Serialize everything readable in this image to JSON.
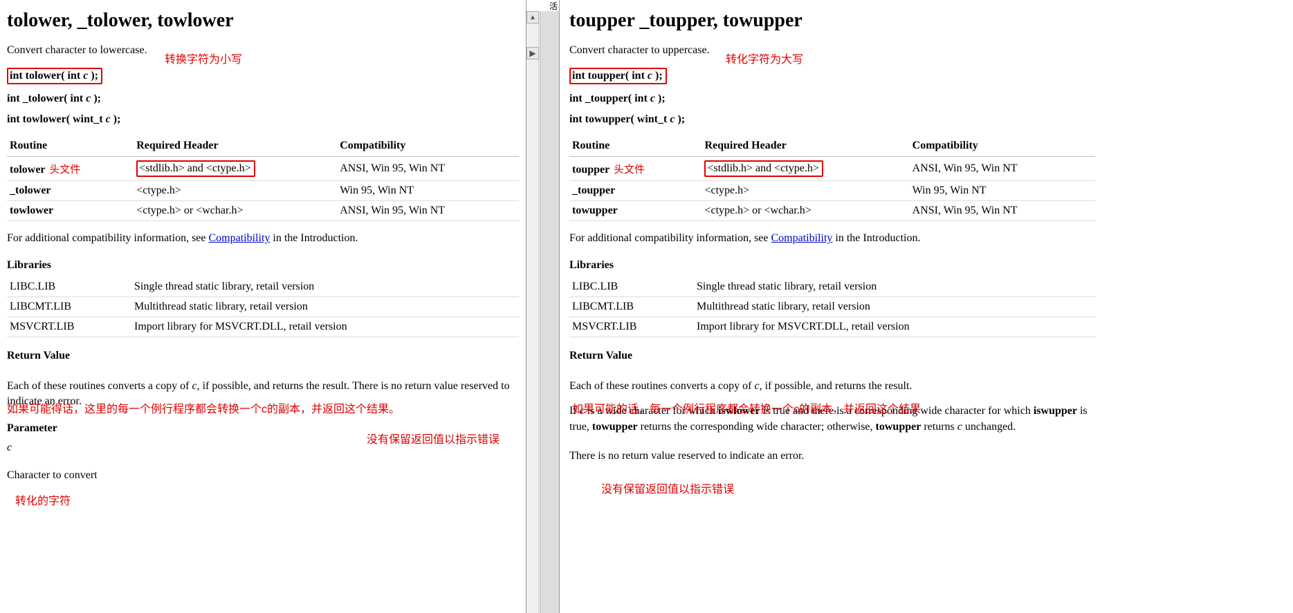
{
  "left": {
    "title": "tolower, _tolower, towlower",
    "desc": "Convert character to lowercase.",
    "desc_annot": "转换字符为小写",
    "sig1_a": "int tolower( int ",
    "sig1_b": "c",
    "sig1_c": " );",
    "sig2_a": "int _tolower( int ",
    "sig2_b": "c",
    "sig2_c": " );",
    "sig3_a": "int towlower( wint_t ",
    "sig3_b": "c",
    "sig3_c": " );",
    "tbl_h1": "Routine",
    "tbl_h2": "Required Header",
    "tbl_h3": "Compatibility",
    "r1_c1": "tolower",
    "r1_annot": "头文件",
    "r1_c2": "<stdlib.h> and <ctype.h>",
    "r1_c3": "ANSI, Win 95, Win NT",
    "r2_c1": "_tolower",
    "r2_c2": "<ctype.h>",
    "r2_c3": "Win 95, Win NT",
    "r3_c1": "towlower",
    "r3_c2": "<ctype.h> or <wchar.h>",
    "r3_c3": "ANSI, Win 95, Win NT",
    "compat_a": "For additional compatibility information, see ",
    "compat_link": "Compatibility",
    "compat_b": " in the Introduction.",
    "libraries_head": "Libraries",
    "lib1_a": "LIBC.LIB",
    "lib1_b": "Single thread static library, retail version",
    "lib2_a": "LIBCMT.LIB",
    "lib2_b": "Multithread static library, retail version",
    "lib3_a": "MSVCRT.LIB",
    "lib3_b": "Import library for MSVCRT.DLL, retail version",
    "rv_head": "Return Value",
    "rv_annot1": "如果可能得话，这里的每一个例行程序都会转换一个c的副本，并返回这个结果。",
    "rv_text_a": "Each of these routines converts a copy of ",
    "rv_text_b": "c,",
    "rv_text_c": " if possible, and returns the result. There is no return value reserved to indicate an error.",
    "rv_annot2": "没有保留返回值以指示错误",
    "param_head": "Parameter",
    "param_c": "c",
    "param_annot": "转化的字符",
    "param_desc": "Character to convert"
  },
  "right": {
    "title": "toupper _toupper, towupper",
    "desc": "Convert character to uppercase.",
    "desc_annot": "转化字符为大写",
    "sig1_a": "int toupper( int ",
    "sig1_b": "c",
    "sig1_c": " );",
    "sig2_a": "int _toupper( int ",
    "sig2_b": "c",
    "sig2_c": " );",
    "sig3_a": "int towupper( wint_t ",
    "sig3_b": "c",
    "sig3_c": " );",
    "tbl_h1": "Routine",
    "tbl_h2": "Required Header",
    "tbl_h3": "Compatibility",
    "r1_c1": "toupper",
    "r1_annot": "头文件",
    "r1_c2": "<stdlib.h> and <ctype.h>",
    "r1_c3": "ANSI, Win 95, Win NT",
    "r2_c1": "_toupper",
    "r2_c2": "<ctype.h>",
    "r2_c3": "Win 95, Win NT",
    "r3_c1": "towupper",
    "r3_c2": "<ctype.h> or <wchar.h>",
    "r3_c3": "ANSI, Win 95, Win NT",
    "compat_a": "For additional compatibility information, see ",
    "compat_link": "Compatibility",
    "compat_b": " in the Introduction.",
    "libraries_head": "Libraries",
    "lib1_a": "LIBC.LIB",
    "lib1_b": "Single thread static library, retail version",
    "lib2_a": "LIBCMT.LIB",
    "lib2_b": "Multithread static library, retail version",
    "lib3_a": "MSVCRT.LIB",
    "lib3_b": "Import library for MSVCRT.DLL, retail version",
    "rv_head": "Return Value",
    "rv_annot1": "如果可能的话，每一个例行程序都会转换一个c的副本，并返回这个结果",
    "rv_text_a": "Each of these routines converts a copy of ",
    "rv_text_b": "c,",
    "rv_text_c": " if possible, and returns the result.",
    "wide_a": "If ",
    "wide_b": "c",
    "wide_c": " is a wide character for which ",
    "wide_d": "iswlower",
    "wide_e": " is true and there is a corresponding wide character for which ",
    "wide_f": "iswupper",
    "wide_g": " is true, ",
    "wide_h": "towupper",
    "wide_i": " returns the corresponding wide character; otherwise, ",
    "wide_j": "towupper",
    "wide_k": " returns ",
    "wide_l": "c",
    "wide_m": " unchanged.",
    "rv_annot2": "没有保留返回值以指示错误",
    "err_text": "There is no return value reserved to indicate an error."
  },
  "divider_label": "活"
}
